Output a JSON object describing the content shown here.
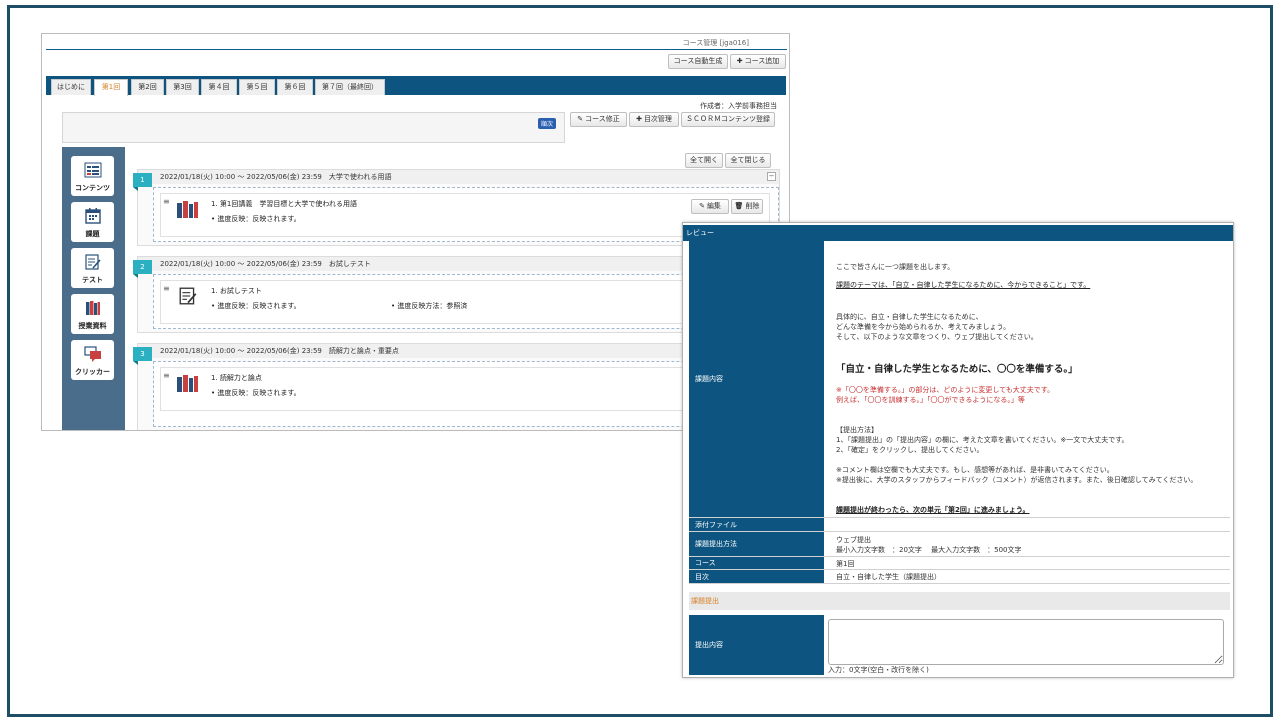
{
  "course_window": {
    "title": "コース管理 [jga016]",
    "buttons": {
      "auto_generate": "コース自動生成",
      "add_course": "コース追加"
    },
    "tabs": [
      "はじめに",
      "第1回",
      "第2回",
      "第3回",
      "第４回",
      "第５回",
      "第６回",
      "第７回（最終回）"
    ],
    "active_tab": "第1回",
    "author": "作成者：入学前事務担当",
    "order_badge": "順次",
    "actions": {
      "edit_course": "コース修正",
      "toc_manage": "目次管理",
      "scorm": "ＳＣＯＲＭコンテンツ登録"
    },
    "expand_all": "全て開く",
    "collapse_all": "全て閉じる",
    "sidebar": [
      {
        "label": "コンテンツ",
        "icon": "content-list-icon"
      },
      {
        "label": "課題",
        "icon": "assignment-calendar-icon"
      },
      {
        "label": "テスト",
        "icon": "test-notepad-icon"
      },
      {
        "label": "授業資料",
        "icon": "class-materials-books-icon"
      },
      {
        "label": "クリッカー",
        "icon": "clicker-chat-icon"
      }
    ],
    "sections": [
      {
        "num": "1",
        "header": "2022/01/18(火) 10:00 ～ 2022/05/06(金) 23:59　大学で使われる用語",
        "entry_title": "1. 第1回講義　学習目標と大学で使われる用語",
        "note1": "• 進度反映：反映されます。",
        "note2": "",
        "edit": "編集",
        "delete": "削除"
      },
      {
        "num": "2",
        "header": "2022/01/18(火) 10:00 ～ 2022/05/06(金) 23:59　お試しテスト",
        "entry_title": "1. お試しテスト",
        "note1": "• 進度反映：反映されます。",
        "note2": "• 進度反映方法：参照済"
      },
      {
        "num": "3",
        "header": "2022/01/18(火) 10:00 ～ 2022/05/06(金) 23:59　読解力と論点・重要点",
        "entry_title": "1. 読解力と論点",
        "note1": "• 進度反映：反映されます。",
        "note2": ""
      }
    ]
  },
  "preview_window": {
    "header": "レビュー",
    "rows": {
      "content_label": "課題内容",
      "attachment_label": "添付ファイル",
      "method_label": "課題提出方法",
      "method_value1": "ウェブ提出",
      "method_value2": "最小入力文字数　：20文字　 最大入力文字数　：500文字",
      "course_label": "コース",
      "course_value": "第1回",
      "toc_label": "目次",
      "toc_value": "自立・自律した学生（課題提出）"
    },
    "content": {
      "line1": "ここで皆さんに一つ課題を出します。",
      "line2": "課題のテーマは、「自立・自律した学生になるために、今からできること」です。",
      "line3": "具体的に、自立・自律した学生になるために、",
      "line4": "どんな準備を今から始められるか、考えてみましょう。",
      "line5": "そして、以下のような文章をつくり、ウェブ提出してください。",
      "big": "「自立・自律した学生となるために、〇〇を準備する。」",
      "red1": "※「〇〇を準備する。」の部分は、どのように変更しても大丈夫です。",
      "red2": "例えば、「〇〇を訓練する。」「〇〇ができるようになる。」等",
      "m1": "【提出方法】",
      "m2": "1、「課題提出」の「提出内容」の欄に、考えた文章を書いてください。※一文で大丈夫です。",
      "m3": "2、「確定」をクリックし、提出してください。",
      "c1": "※コメント欄は空欄でも大丈夫です。もし、感想等があれば、是非書いてみてください。",
      "c2": "※提出後に、大学のスタッフからフィードバック（コメント）が返信されます。また、後日確認してみてください。",
      "last": "課題提出が終わったら、次の単元「第2回」に進みましょう。"
    },
    "submission": {
      "section_title": "課題提出",
      "content_label": "提出内容",
      "counter": "入力：0文字(空白・改行を除く)"
    }
  },
  "colors": {
    "navy": "#0d5580",
    "accent_orange": "#d4822a",
    "teal_badge": "#2bb0c2",
    "sidebar": "#4a6d8c",
    "warning_red": "#c83030"
  }
}
